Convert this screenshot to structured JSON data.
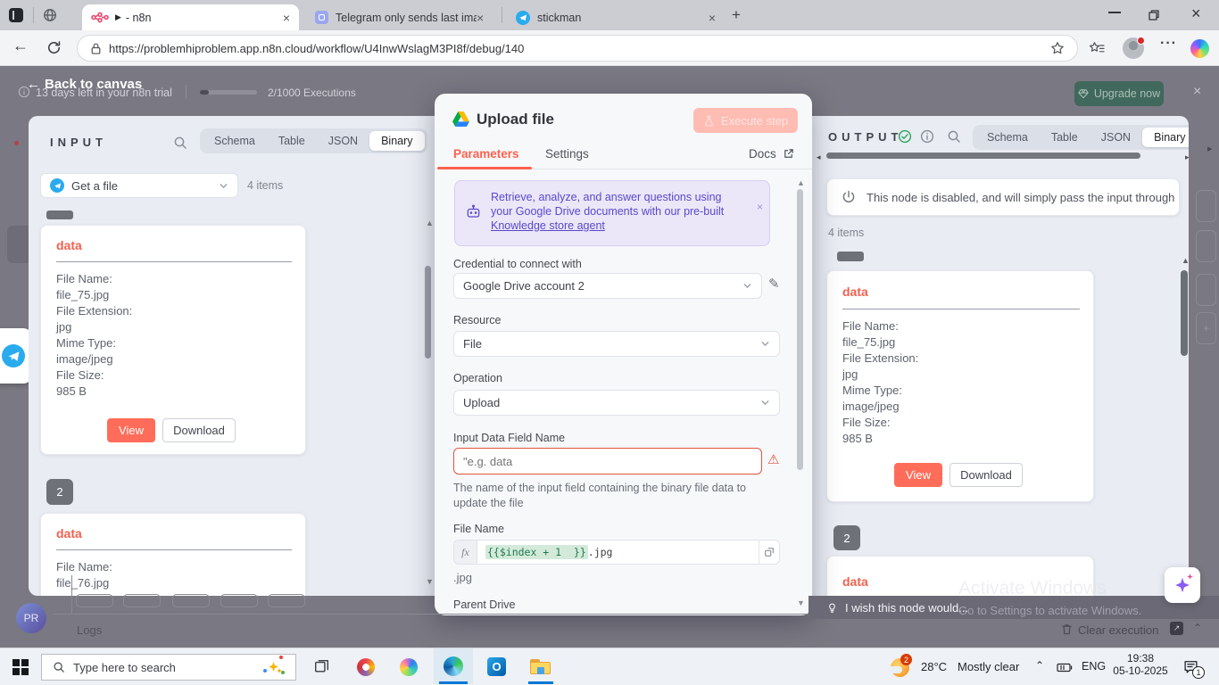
{
  "colors": {
    "accent_orange": "#FF6150",
    "error_red": "#E0533F",
    "success_green": "#2AA558",
    "callout_purple": "#5A48C9",
    "expression_green_bg": "#D3EADB",
    "expression_green_text": "#20794D",
    "taskbar_active_blue": "#0077D6"
  },
  "browser": {
    "tabs": [
      {
        "play": "▶",
        "title": "- n8n"
      },
      {
        "title": "Telegram only sends last image wi"
      },
      {
        "title": "stickman"
      }
    ],
    "new_tab": "+",
    "url": "https://problemhiproblem.app.n8n.cloud/workflow/U4InwWslagM3PI8f/debug/140"
  },
  "app_header": {
    "back": "Back to canvas",
    "trial": "13 days left in your n8n trial",
    "executions": "2/1000 Executions",
    "upgrade": "Upgrade now"
  },
  "input_panel": {
    "title": "INPUT",
    "tabs": [
      "Schema",
      "Table",
      "JSON",
      "Binary"
    ],
    "source": "Get a file",
    "items": "4 items",
    "badge": "2"
  },
  "file_card": {
    "title": "data",
    "fields": [
      {
        "label": "File Name:",
        "value": "file_75.jpg"
      },
      {
        "label": "File Extension:",
        "value": "jpg"
      },
      {
        "label": "Mime Type:",
        "value": "image/jpeg"
      },
      {
        "label": "File Size:",
        "value": "985 B"
      }
    ],
    "view": "View",
    "download": "Download"
  },
  "file_card_2": {
    "title": "data",
    "label": "File Name:",
    "value": "file_76.jpg"
  },
  "modal": {
    "title": "Upload file",
    "execute": "Execute step",
    "tabs": {
      "parameters": "Parameters",
      "settings": "Settings"
    },
    "docs": "Docs",
    "callout": {
      "line1": "Retrieve, analyze, and answer questions using",
      "line2": "your Google Drive documents with our pre-built",
      "link": "Knowledge store agent"
    },
    "credential": {
      "label": "Credential to connect with",
      "value": "Google Drive account 2"
    },
    "resource": {
      "label": "Resource",
      "value": "File"
    },
    "operation": {
      "label": "Operation",
      "value": "Upload"
    },
    "input_field": {
      "label": "Input Data Field Name",
      "placeholder": "\"e.g. data",
      "help": "The name of the input field containing the binary file data to update the file"
    },
    "file_name": {
      "label": "File Name",
      "fx": "fx",
      "expression": "{{$index + 1  }}",
      "suffix": ".jpg",
      "preview": ".jpg"
    },
    "parent_drive": {
      "label": "Parent Drive"
    }
  },
  "output_panel": {
    "title": "OUTPUT",
    "tabs": [
      "Schema",
      "Table",
      "JSON",
      "Binary"
    ],
    "notice": "This node is disabled, and will simply pass the input through",
    "items": "4 items",
    "badge": "2",
    "card2_title": "data"
  },
  "footer": {
    "logs": "Logs",
    "tip": "I wish this node would...",
    "clear": "Clear execution"
  },
  "watermark": {
    "line1": "Activate Windows",
    "line2": "Go to Settings to activate Windows."
  },
  "taskbar": {
    "search": "Type here to search",
    "temp": "28°C",
    "weather": "Mostly clear",
    "weather_badge": "2",
    "lang": "ENG",
    "time": "19:38",
    "date": "05-10-2025",
    "notif_badge": "1"
  }
}
